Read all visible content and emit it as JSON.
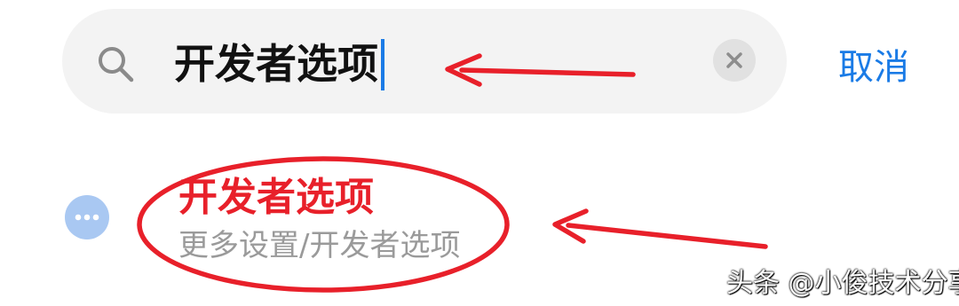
{
  "search": {
    "query": "开发者选项",
    "cancel_label": "取消"
  },
  "result": {
    "title": "开发者选项",
    "path": "更多设置/开发者选项",
    "icon": "more-dots-icon"
  },
  "annotations": {
    "arrow_color": "#e8202a",
    "title_color": "#e8202a"
  },
  "watermark": "头条 @小俊技术分享",
  "colors": {
    "accent": "#1a7be6",
    "search_bg": "#f3f3f3",
    "icon_bg": "#a9c8f2",
    "secondary_text": "#9a9a9a"
  }
}
